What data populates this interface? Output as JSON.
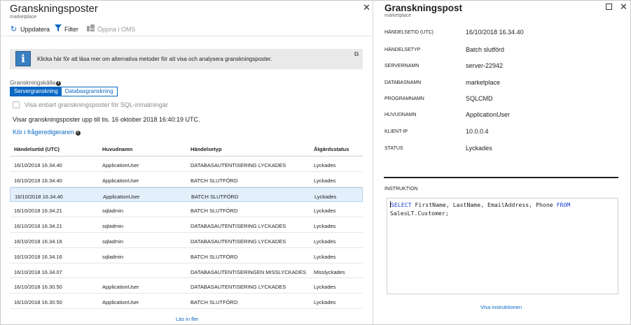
{
  "left_blade": {
    "title": "Granskningsposter",
    "subtitle": "marketplace",
    "toolbar": {
      "refresh": "Uppdatera",
      "filter": "Filter",
      "open_oms": "Öppna i OMS"
    },
    "info_banner": "Klicka här för att läsa mer om alternativa metoder för att visa och analysera granskningsposter.",
    "source_label": "Granskningskälla",
    "source_options": [
      "Servergranskning",
      "Databasgranskning"
    ],
    "source_selected": "Servergranskning",
    "checkbox_label": "Visa enbart granskningsposter för SQL-inmatningar",
    "showing_text": "Visar granskningsposter upp till tis. 16 oktober 2018 16:40:19 UTC.",
    "query_editor_link": "Kör i frågeredigeraren",
    "grid": {
      "columns": [
        "Händelsetid (UTC)",
        "Huvudnamn",
        "Händelsetyp",
        "Åtgärdsstatus"
      ],
      "rows": [
        [
          "16/10/2018 16.34.40",
          "ApplicationUser",
          "DATABASAUTENTISERING LYCKADES",
          "Lyckades"
        ],
        [
          "16/10/2018 16.34.40",
          "ApplicationUser",
          "BATCH SLUTFÖRD",
          "Lyckades"
        ],
        [
          "16/10/2018 16.34.40",
          "ApplicationUser",
          "BATCH SLUTFÖRD",
          "Lyckades"
        ],
        [
          "16/10/2018 16.34.21",
          "sqladmin",
          "BATCH SLUTFÖRD",
          "Lyckades"
        ],
        [
          "16/10/2018 16.34.21",
          "sqladmin",
          "DATABASAUTENTISERING LYCKADES",
          "Lyckades"
        ],
        [
          "16/10/2018 16.34.16",
          "sqladmin",
          "DATABASAUTENTISERING LYCKADES",
          "Lyckades"
        ],
        [
          "16/10/2018 16.34.16",
          "sqladmin",
          "BATCH SLUTFÖRD",
          "Lyckades"
        ],
        [
          "16/10/2018 16.34.07",
          "",
          "DATABASAUTENTISERINGEN MISSLYCKADES",
          "Misslyckades"
        ],
        [
          "16/10/2018 16.30.50",
          "ApplicationUser",
          "DATABASAUTENTISERING LYCKADES",
          "Lyckades"
        ],
        [
          "16/10/2018 16.30.50",
          "ApplicationUser",
          "BATCH SLUTFÖRD",
          "Lyckades"
        ]
      ],
      "selected_row": 2
    },
    "load_more": "Läs in fler"
  },
  "right_blade": {
    "title": "Granskningspost",
    "subtitle": "marketplace",
    "fields": [
      {
        "label": "HÄNDELSETID (UTC)",
        "value": "16/10/2018 16.34.40"
      },
      {
        "label": "HÄNDELSETYP",
        "value": "Batch slutförd"
      },
      {
        "label": "SERVERNAMN",
        "value": "server-22942"
      },
      {
        "label": "DATABASNAMN",
        "value": "marketplace"
      },
      {
        "label": "PROGRAMNAMN",
        "value": "SQLCMD"
      },
      {
        "label": "HUVUDNAMN",
        "value": "ApplicationUser"
      },
      {
        "label": "KLIENT-IP",
        "value": "10.0.0.4"
      },
      {
        "label": "STATUS",
        "value": "Lyckades"
      }
    ],
    "instruction_label": "INSTRUKTION",
    "statement": {
      "kw1": "SELECT",
      "mid": " FirstName, LastName, EmailAddress, Phone ",
      "kw2": "FROM",
      "line2": "SalesLT.Customer;"
    },
    "show_instruction": "Visa instruktionen"
  },
  "colors": {
    "accent": "#0a68c4",
    "selected_row": "#e3effb",
    "info_bg": "#e9e9e9",
    "keyword": "#1a3fd1"
  }
}
